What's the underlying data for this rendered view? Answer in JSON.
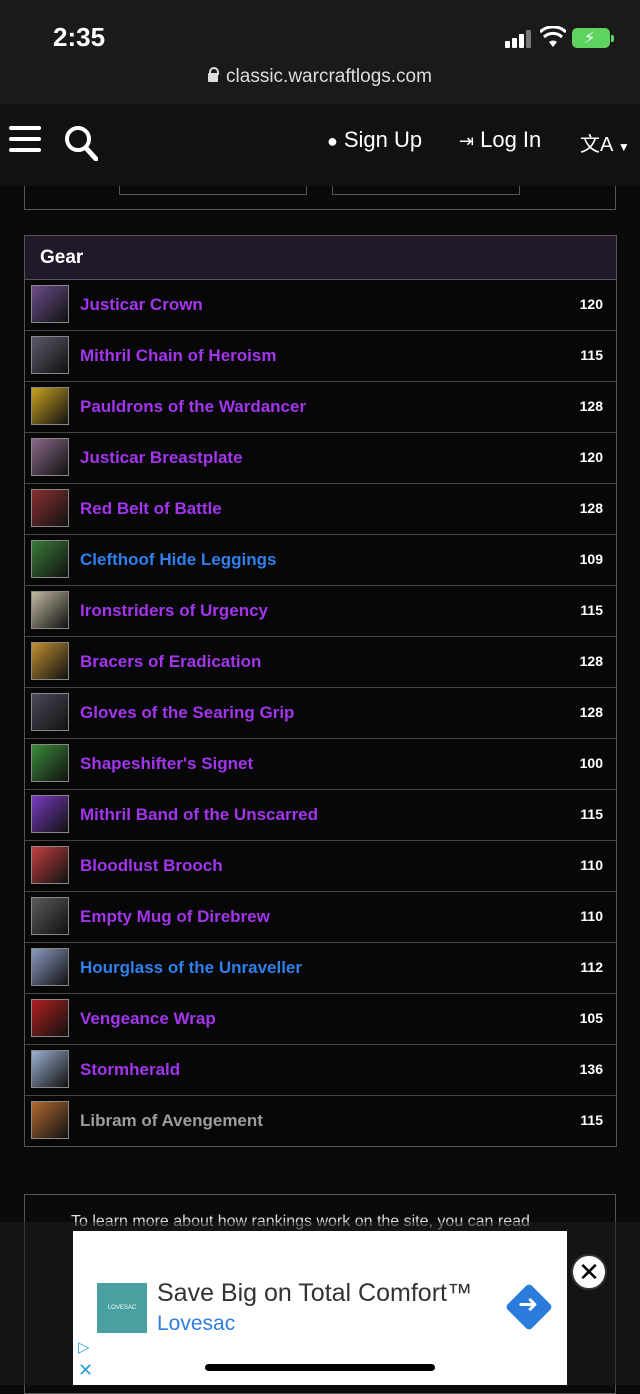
{
  "status_bar": {
    "time": "2:35"
  },
  "browser": {
    "url": "classic.warcraftlogs.com"
  },
  "nav": {
    "sign_up": "Sign Up",
    "log_in": "Log In",
    "language_glyph": "文A"
  },
  "gear": {
    "header": "Gear",
    "items": [
      {
        "name": "Justicar Crown",
        "ilvl": "120",
        "quality": "epic",
        "icon_color": "#6b4e8a"
      },
      {
        "name": "Mithril Chain of Heroism",
        "ilvl": "115",
        "quality": "epic",
        "icon_color": "#5a5a6a"
      },
      {
        "name": "Pauldrons of the Wardancer",
        "ilvl": "128",
        "quality": "epic",
        "icon_color": "#c8a020"
      },
      {
        "name": "Justicar Breastplate",
        "ilvl": "120",
        "quality": "epic",
        "icon_color": "#8a6a8a"
      },
      {
        "name": "Red Belt of Battle",
        "ilvl": "128",
        "quality": "epic",
        "icon_color": "#8a3030"
      },
      {
        "name": "Clefthoof Hide Leggings",
        "ilvl": "109",
        "quality": "rare",
        "icon_color": "#3a7a3a"
      },
      {
        "name": "Ironstriders of Urgency",
        "ilvl": "115",
        "quality": "epic",
        "icon_color": "#c0b8a0"
      },
      {
        "name": "Bracers of Eradication",
        "ilvl": "128",
        "quality": "epic",
        "icon_color": "#c09030"
      },
      {
        "name": "Gloves of the Searing Grip",
        "ilvl": "128",
        "quality": "epic",
        "icon_color": "#4a4a5a"
      },
      {
        "name": "Shapeshifter's Signet",
        "ilvl": "100",
        "quality": "epic",
        "icon_color": "#3a8a3a"
      },
      {
        "name": "Mithril Band of the Unscarred",
        "ilvl": "115",
        "quality": "epic",
        "icon_color": "#7a3ac0"
      },
      {
        "name": "Bloodlust Brooch",
        "ilvl": "110",
        "quality": "epic",
        "icon_color": "#c04040"
      },
      {
        "name": "Empty Mug of Direbrew",
        "ilvl": "110",
        "quality": "epic",
        "icon_color": "#5a5a5a"
      },
      {
        "name": "Hourglass of the Unraveller",
        "ilvl": "112",
        "quality": "rare",
        "icon_color": "#8a9ac0"
      },
      {
        "name": "Vengeance Wrap",
        "ilvl": "105",
        "quality": "epic",
        "icon_color": "#b02020"
      },
      {
        "name": "Stormherald",
        "ilvl": "136",
        "quality": "epic",
        "icon_color": "#9ab0d0"
      },
      {
        "name": "Libram of Avengement",
        "ilvl": "115",
        "quality": "common",
        "icon_color": "#b06a30"
      }
    ]
  },
  "info": {
    "text": "To learn more about how rankings work on the site, you can read"
  },
  "ad": {
    "logo_text": "LOVESAC",
    "title": "Save Big on Total Comfort™",
    "advertiser": "Lovesac",
    "close_glyph": "✕"
  }
}
